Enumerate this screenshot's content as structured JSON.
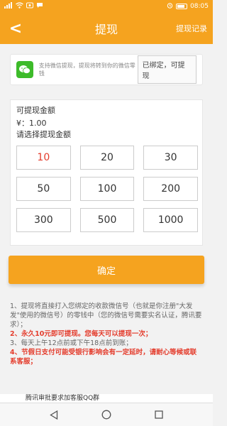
{
  "statusbar": {
    "time": "08:05"
  },
  "appbar": {
    "title": "提现",
    "record": "提现记录",
    "back": "<"
  },
  "wechat": {
    "text": "支持微信提现，提现将转到你的微信零钱",
    "bound_label": "已绑定，可提现"
  },
  "withdraw": {
    "available_label": "可提现金额",
    "available_value": "¥：1.00",
    "choose_label": "请选择提现金额",
    "amounts": [
      "10",
      "20",
      "30",
      "50",
      "100",
      "200",
      "300",
      "500",
      "1000"
    ],
    "selected": "10"
  },
  "confirm_label": "确定",
  "notes": [
    "1、提现将直接打入您绑定的收款微信号（也就是你注册\"大发发\"使用的微信号）的零钱中（您的微信号需要实名认证，腾讯要求）；",
    "2、永久10元即可提现。您每天可以提现一次；",
    "3、每天上午12点前或下午18点前到账；",
    "4、节假日支付可能受银行影响会有一定延时，请耐心等候或联系客服；"
  ],
  "bottom_strip": "腾讯审批要求加客服QQ群",
  "colors": {
    "primary": "#f5a31f",
    "wechat": "#3dbb2a",
    "accent_red": "#e43c2c"
  }
}
